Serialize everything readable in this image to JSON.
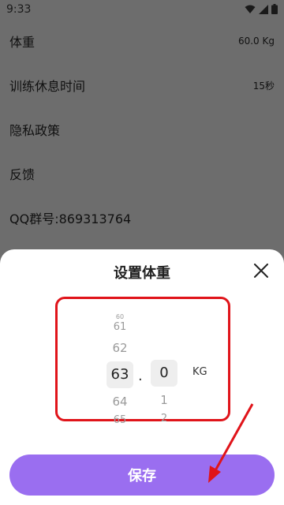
{
  "status_bar": {
    "time": "9:33"
  },
  "settings": [
    {
      "label": "体重",
      "value": "60.0 Kg"
    },
    {
      "label": "训练休息时间",
      "value": "15秒"
    },
    {
      "label": "隐私政策",
      "value": ""
    },
    {
      "label": "反馈",
      "value": ""
    },
    {
      "label": "QQ群号:869313764",
      "value": ""
    }
  ],
  "sheet": {
    "title": "设置体重",
    "unit": "KG",
    "decimal_separator": ".",
    "integer_wheel": {
      "above": [
        "60",
        "61",
        "62"
      ],
      "selected": "63",
      "below": [
        "64",
        "65"
      ]
    },
    "decimal_wheel": {
      "selected": "0",
      "below": [
        "1",
        "2"
      ]
    },
    "save_label": "保存"
  },
  "colors": {
    "accent": "#9a6ef0",
    "annotation": "#e0141a"
  }
}
